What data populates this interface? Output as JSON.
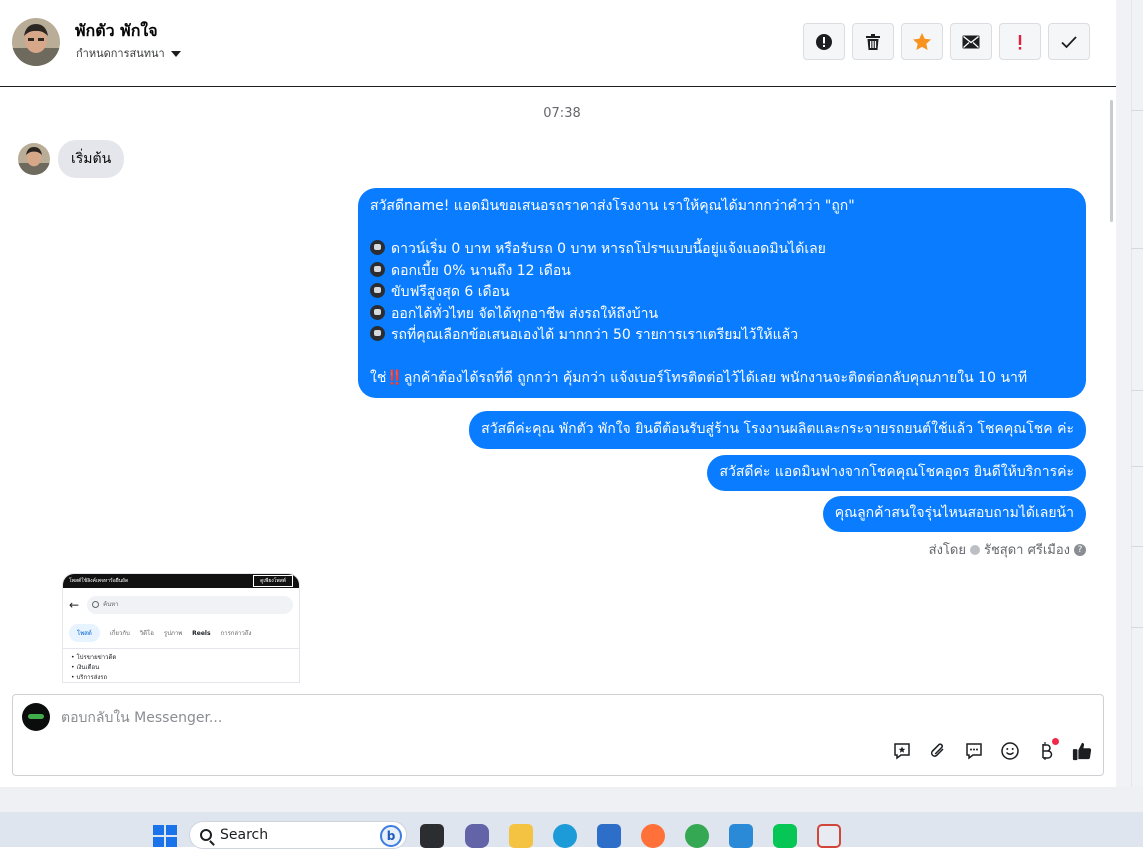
{
  "header": {
    "contact_name": "พักตัว พักใจ",
    "label_select": "กำหนดการสนทนา",
    "toolbar": [
      "spam-icon",
      "trash-icon",
      "star-icon",
      "mail-icon",
      "important-icon",
      "check-icon"
    ]
  },
  "thread": {
    "time": "07:38",
    "received": [
      {
        "text": "เริ่มต้น"
      }
    ],
    "sent": [
      {
        "lines": [
          "สวัสดีname! แอดมินขอเสนอรถราคาส่งโรงงาน เราให้คุณได้มากกว่าคำว่า \"ถูก\"",
          "",
          "ดาวน์เริ่ม 0 บาท หรือรับรถ 0 บาท หารถโปรฯแบบนี้อยู่แจ้งแอดมินได้เลย",
          "ดอกเบี้ย 0% นานถึง 12 เดือน",
          "ขับฟรีสูงสุด 6 เดือน",
          "ออกได้ทั่วไทย จัดได้ทุกอาชีพ ส่งรถให้ถึงบ้าน",
          "รถที่คุณเลือกข้อเสนอเองได้ มากกว่า 50 รายการเราเตรียมไว้ให้แล้ว",
          "",
          "ใช่",
          "‼️",
          "ลูกค้าต้องได้รถที่ดี ถูกกว่า คุ้มกว่า แจ้งเบอร์โทรติดต่อไว้ได้เลย พนักงานจะติดต่อกลับคุณภายใน 10 นาที"
        ]
      },
      {
        "text": "สวัสดีค่ะคุณ พักตัว พักใจ ยินดีต้อนรับสู่ร้าน โรงงานผลิตและกระจายรถยนต์ใช้แล้ว โชคคุณโชค ค่ะ"
      },
      {
        "text": "สวัสดีค่ะ แอดมินฟางจากโชคคุณโชคอุดร ยินดีให้บริการค่ะ"
      },
      {
        "text": "คุณลูกค้าสนใจรุ่นไหนสอบถามได้เลยน้า"
      }
    ],
    "sent_by_prefix": "ส่งโดย",
    "sent_by_name": "รัชสุดา ศรีเมือง",
    "attachment": {
      "topbar_text": "โพสต์ใช้ลิงค์เพจหาร้อยืนยัด",
      "topbar_button": "ดูเพียงโพสต์",
      "search_placeholder": "ค้นหา",
      "chips": [
        "โพสต์",
        "เกี่ยวกับ",
        "วิดีโอ",
        "รูปภาพ",
        "Reels",
        "การกล่าวถึง"
      ],
      "list": [
        "• โปรขายข่าวดีด",
        "• เงินเดือน",
        "• บริการส่งรถ"
      ]
    }
  },
  "composer": {
    "placeholder": "ตอบกลับใน Messenger...",
    "icons": [
      "saved-reply-icon",
      "attach-icon",
      "quick-reply-icon",
      "emoji-icon",
      "payment-icon",
      "like-icon"
    ]
  },
  "taskbar": {
    "search_label": "Search",
    "bing_label": "b",
    "apps": [
      "file-manager",
      "teams",
      "explorer",
      "edge",
      "store",
      "firefox",
      "chrome",
      "notepad",
      "line",
      "snipping-tool"
    ]
  },
  "colors": {
    "outgoing_bubble": "#0a7cff",
    "incoming_bubble": "#e4e6eb",
    "star": "#f7931e",
    "important": "#e41e3f"
  }
}
